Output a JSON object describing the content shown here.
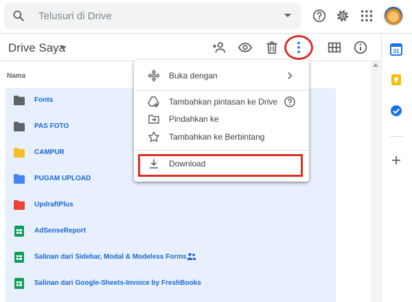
{
  "search": {
    "placeholder": "Telusuri di Drive"
  },
  "toolbar": {
    "title": "Drive Saya"
  },
  "list": {
    "header": "Nama",
    "items": [
      {
        "name": "Fonts",
        "type": "folder",
        "color": "#5f6368"
      },
      {
        "name": "PAS FOTO",
        "type": "folder",
        "color": "#5f6368"
      },
      {
        "name": "CAMPUR",
        "type": "folder",
        "color": "#f6bf26"
      },
      {
        "name": "PUGAM UPLOAD",
        "type": "folder",
        "color": "#4285f4"
      },
      {
        "name": "UpdraftPlus",
        "type": "folder",
        "color": "#ea4335"
      },
      {
        "name": "AdSenseReport",
        "type": "sheet",
        "color": "#0f9d58"
      },
      {
        "name": "Salinan dari Sidebar, Modal & Modeless Forms",
        "type": "sheet",
        "color": "#0f9d58",
        "shared": true
      },
      {
        "name": "Salinan dari Google-Sheets-Invoice by FreshBooks",
        "type": "sheet",
        "color": "#0f9d58"
      }
    ]
  },
  "menu": {
    "items": [
      {
        "label": "Buka dengan",
        "icon": "move-icon",
        "right": "chevron-right-icon"
      },
      {
        "label": "Tambahkan pintasan ke Drive",
        "icon": "add-shortcut-icon",
        "right": "help-icon"
      },
      {
        "label": "Pindahkan ke",
        "icon": "move-to-icon"
      },
      {
        "label": "Tambahkan ke Berbintang",
        "icon": "star-icon"
      },
      {
        "label": "Download",
        "icon": "download-icon"
      }
    ]
  },
  "side_panel": {
    "calendar_day": "31"
  },
  "colors": {
    "accent": "#1967d2",
    "highlight": "#d93025",
    "selection": "#e8f0fe"
  }
}
